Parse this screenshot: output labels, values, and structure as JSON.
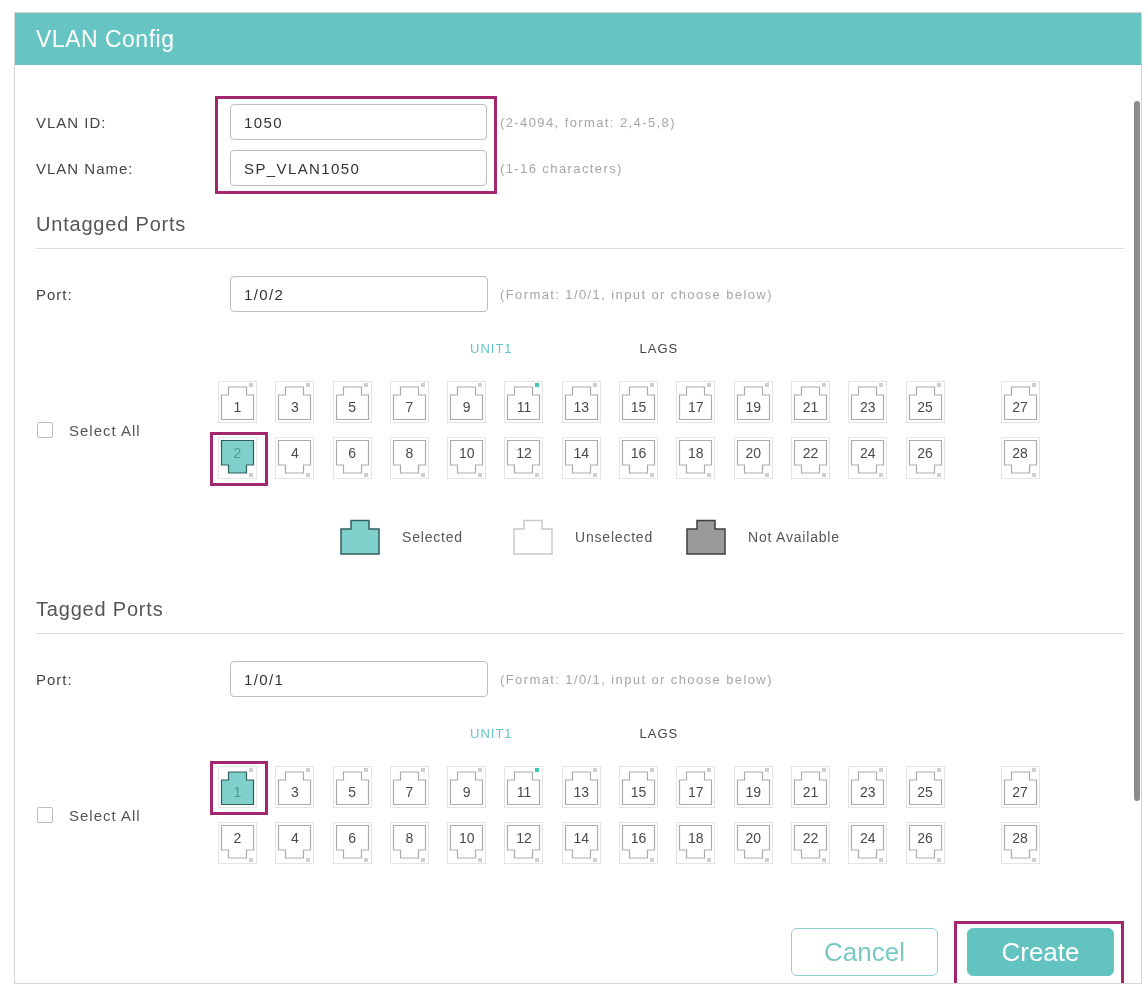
{
  "dialog": {
    "title": "VLAN Config"
  },
  "vlan_fields": {
    "highlighted": true,
    "fields": [
      {
        "label": "VLAN ID:",
        "value": "1050",
        "hint": "(2-4094, format: 2,4-5,8)"
      },
      {
        "label": "VLAN Name:",
        "value": "SP_VLAN1050",
        "hint": "(1-16 characters)"
      }
    ]
  },
  "sections": [
    {
      "title": "Untagged Ports",
      "port_field": {
        "label": "Port:",
        "value": "1/0/2",
        "hint": "(Format: 1/0/1, input or choose below)"
      },
      "tabs": [
        {
          "label": "UNIT1",
          "selected": true
        },
        {
          "label": "LAGS",
          "selected": false
        }
      ],
      "select_all": {
        "label": "Select All",
        "checked": false
      },
      "port_groups": [
        {
          "ports": [
            {
              "label": "1",
              "selected": false,
              "link": false,
              "highlighted": false
            },
            {
              "label": "2",
              "selected": true,
              "link": false,
              "highlighted": true
            },
            {
              "label": "3",
              "selected": false,
              "link": false,
              "highlighted": false
            },
            {
              "label": "4",
              "selected": false,
              "link": false,
              "highlighted": false
            },
            {
              "label": "5",
              "selected": false,
              "link": false,
              "highlighted": false
            },
            {
              "label": "6",
              "selected": false,
              "link": false,
              "highlighted": false
            },
            {
              "label": "7",
              "selected": false,
              "link": false,
              "highlighted": false
            },
            {
              "label": "8",
              "selected": false,
              "link": false,
              "highlighted": false
            },
            {
              "label": "9",
              "selected": false,
              "link": false,
              "highlighted": false
            },
            {
              "label": "10",
              "selected": false,
              "link": false,
              "highlighted": false
            },
            {
              "label": "11",
              "selected": false,
              "link": true,
              "highlighted": false
            },
            {
              "label": "12",
              "selected": false,
              "link": false,
              "highlighted": false
            },
            {
              "label": "13",
              "selected": false,
              "link": false,
              "highlighted": false
            },
            {
              "label": "14",
              "selected": false,
              "link": false,
              "highlighted": false
            },
            {
              "label": "15",
              "selected": false,
              "link": false,
              "highlighted": false
            },
            {
              "label": "16",
              "selected": false,
              "link": false,
              "highlighted": false
            },
            {
              "label": "17",
              "selected": false,
              "link": false,
              "highlighted": false
            },
            {
              "label": "18",
              "selected": false,
              "link": false,
              "highlighted": false
            },
            {
              "label": "19",
              "selected": false,
              "link": false,
              "highlighted": false
            },
            {
              "label": "20",
              "selected": false,
              "link": false,
              "highlighted": false
            },
            {
              "label": "21",
              "selected": false,
              "link": false,
              "highlighted": false
            },
            {
              "label": "22",
              "selected": false,
              "link": false,
              "highlighted": false
            },
            {
              "label": "23",
              "selected": false,
              "link": false,
              "highlighted": false
            },
            {
              "label": "24",
              "selected": false,
              "link": false,
              "highlighted": false
            },
            {
              "label": "25",
              "selected": false,
              "link": false,
              "highlighted": false
            },
            {
              "label": "26",
              "selected": false,
              "link": false,
              "highlighted": false
            }
          ]
        },
        {
          "ports": [
            {
              "label": "27",
              "selected": false,
              "link": false,
              "highlighted": false
            },
            {
              "label": "28",
              "selected": false,
              "link": false,
              "highlighted": false
            }
          ]
        }
      ],
      "legend": [
        {
          "label": "Selected",
          "kind": "selected"
        },
        {
          "label": "Unselected",
          "kind": "unselected"
        },
        {
          "label": "Not Available",
          "kind": "unavailable"
        }
      ]
    },
    {
      "title": "Tagged Ports",
      "port_field": {
        "label": "Port:",
        "value": "1/0/1",
        "hint": "(Format: 1/0/1, input or choose below)"
      },
      "tabs": [
        {
          "label": "UNIT1",
          "selected": true
        },
        {
          "label": "LAGS",
          "selected": false
        }
      ],
      "select_all": {
        "label": "Select All",
        "checked": false
      },
      "port_groups": [
        {
          "ports": [
            {
              "label": "1",
              "selected": true,
              "link": false,
              "highlighted": true
            },
            {
              "label": "2",
              "selected": false,
              "link": false,
              "highlighted": false
            },
            {
              "label": "3",
              "selected": false,
              "link": false,
              "highlighted": false
            },
            {
              "label": "4",
              "selected": false,
              "link": false,
              "highlighted": false
            },
            {
              "label": "5",
              "selected": false,
              "link": false,
              "highlighted": false
            },
            {
              "label": "6",
              "selected": false,
              "link": false,
              "highlighted": false
            },
            {
              "label": "7",
              "selected": false,
              "link": false,
              "highlighted": false
            },
            {
              "label": "8",
              "selected": false,
              "link": false,
              "highlighted": false
            },
            {
              "label": "9",
              "selected": false,
              "link": false,
              "highlighted": false
            },
            {
              "label": "10",
              "selected": false,
              "link": false,
              "highlighted": false
            },
            {
              "label": "11",
              "selected": false,
              "link": true,
              "highlighted": false
            },
            {
              "label": "12",
              "selected": false,
              "link": false,
              "highlighted": false
            },
            {
              "label": "13",
              "selected": false,
              "link": false,
              "highlighted": false
            },
            {
              "label": "14",
              "selected": false,
              "link": false,
              "highlighted": false
            },
            {
              "label": "15",
              "selected": false,
              "link": false,
              "highlighted": false
            },
            {
              "label": "16",
              "selected": false,
              "link": false,
              "highlighted": false
            },
            {
              "label": "17",
              "selected": false,
              "link": false,
              "highlighted": false
            },
            {
              "label": "18",
              "selected": false,
              "link": false,
              "highlighted": false
            },
            {
              "label": "19",
              "selected": false,
              "link": false,
              "highlighted": false
            },
            {
              "label": "20",
              "selected": false,
              "link": false,
              "highlighted": false
            },
            {
              "label": "21",
              "selected": false,
              "link": false,
              "highlighted": false
            },
            {
              "label": "22",
              "selected": false,
              "link": false,
              "highlighted": false
            },
            {
              "label": "23",
              "selected": false,
              "link": false,
              "highlighted": false
            },
            {
              "label": "24",
              "selected": false,
              "link": false,
              "highlighted": false
            },
            {
              "label": "25",
              "selected": false,
              "link": false,
              "highlighted": false
            },
            {
              "label": "26",
              "selected": false,
              "link": false,
              "highlighted": false
            }
          ]
        },
        {
          "ports": [
            {
              "label": "27",
              "selected": false,
              "link": false,
              "highlighted": false
            },
            {
              "label": "28",
              "selected": false,
              "link": false,
              "highlighted": false
            }
          ]
        }
      ]
    }
  ],
  "buttons": [
    {
      "label": "Cancel",
      "kind": "secondary",
      "highlighted": false
    },
    {
      "label": "Create",
      "kind": "primary",
      "highlighted": true
    }
  ]
}
